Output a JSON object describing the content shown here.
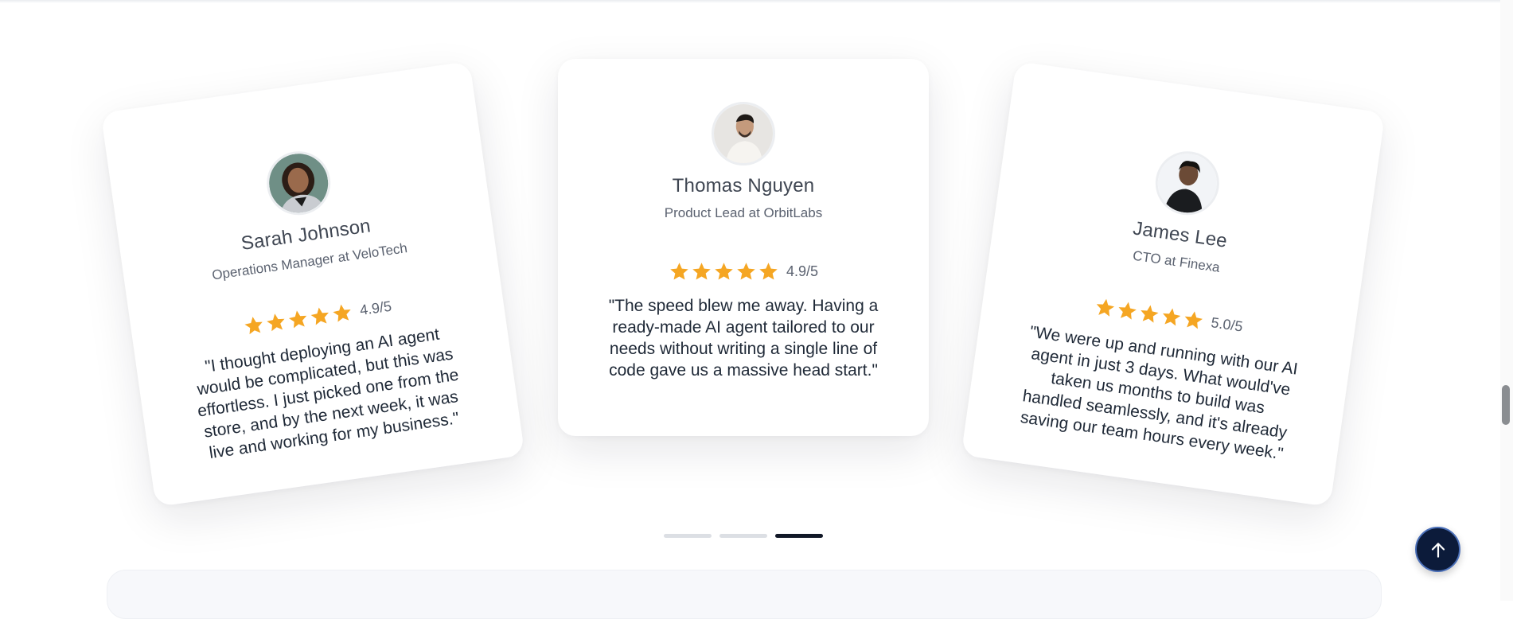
{
  "testimonials": [
    {
      "name": "Sarah Johnson",
      "role": "Operations Manager at VeloTech",
      "rating": "4.9/5",
      "stars": 5,
      "quote": "\"I thought deploying an AI agent would be complicated, but this was effortless. I just picked one from the store, and by the next week, it was live and working for my business.\""
    },
    {
      "name": "Thomas Nguyen",
      "role": "Product Lead at OrbitLabs",
      "rating": "4.9/5",
      "stars": 5,
      "quote": "\"The speed blew me away. Having a ready-made AI agent tailored to our needs without writing a single line of code gave us a massive head start.\""
    },
    {
      "name": "James Lee",
      "role": "CTO at Finexa",
      "rating": "5.0/5",
      "stars": 5,
      "quote": "\"We were up and running with our AI agent in just 3 days. What would've taken us months to build was handled seamlessly, and it's already saving our team hours every week.\""
    }
  ],
  "carousel": {
    "slide_count": 3,
    "active_index": 2
  },
  "colors": {
    "star": "#f5a623",
    "active_dot": "#111827",
    "inactive_dot": "#dcdfe4",
    "scroll_top_button": "#0c1b3a"
  },
  "icons": {
    "star": "star-icon",
    "scroll_top": "arrow-up-icon"
  }
}
